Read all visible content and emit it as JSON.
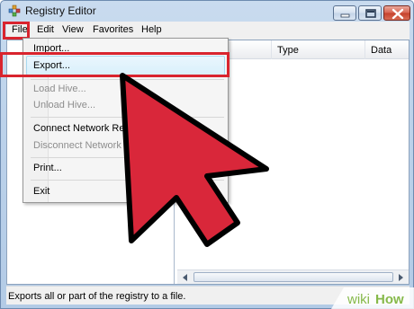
{
  "window": {
    "title": "Registry Editor",
    "buttons": {
      "minimize": "minimize",
      "maximize": "maximize",
      "close": "close"
    }
  },
  "menubar": [
    "File",
    "Edit",
    "View",
    "Favorites",
    "Help"
  ],
  "list": {
    "columns": [
      "Type",
      "Data"
    ]
  },
  "file_menu": {
    "items": [
      {
        "label": "Import...",
        "enabled": true
      },
      {
        "label": "Export...",
        "enabled": true,
        "hovered": true
      },
      {
        "label": "Load Hive...",
        "enabled": false
      },
      {
        "label": "Unload Hive...",
        "enabled": false
      },
      {
        "label": "Connect Network Regi",
        "enabled": true
      },
      {
        "label": "Disconnect Network R",
        "enabled": false
      },
      {
        "label": "Print...",
        "enabled": true
      },
      {
        "label": "Exit",
        "enabled": true
      }
    ]
  },
  "statusbar": {
    "text": "Exports all or part of the registry to a file."
  },
  "watermark": "wikiHow",
  "colors": {
    "highlight": "#d9242e",
    "arrow_fill": "#d9273a",
    "arrow_outline": "#000000",
    "menu_hover": "#d9f0fc"
  }
}
